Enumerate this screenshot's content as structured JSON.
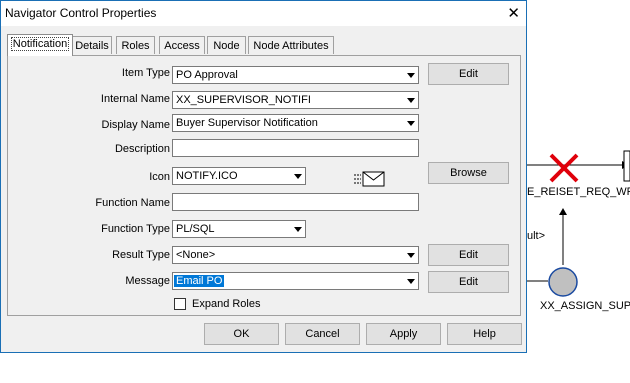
{
  "window": {
    "title": "Navigator Control Properties",
    "close_label": "✕"
  },
  "tabs": [
    {
      "label": "Notification",
      "active": true
    },
    {
      "label": "Details"
    },
    {
      "label": "Roles"
    },
    {
      "label": "Access"
    },
    {
      "label": "Node"
    },
    {
      "label": "Node Attributes"
    }
  ],
  "form": {
    "item_type": {
      "label": "Item Type",
      "value": "PO Approval",
      "edit_label": "Edit"
    },
    "internal_name": {
      "label": "Internal Name",
      "value": "XX_SUPERVISOR_NOTIFI"
    },
    "display_name": {
      "label": "Display Name",
      "value": "Buyer Supervisor Notification"
    },
    "description": {
      "label": "Description",
      "value": ""
    },
    "icon": {
      "label": "Icon",
      "value": "NOTIFY.ICO",
      "browse_label": "Browse",
      "preview": "envelope-icon"
    },
    "function_name": {
      "label": "Function Name",
      "value": ""
    },
    "function_type": {
      "label": "Function Type",
      "value": "PL/SQL"
    },
    "result_type": {
      "label": "Result Type",
      "value": "<None>",
      "edit_label": "Edit"
    },
    "message": {
      "label": "Message",
      "value": "Email PO",
      "edit_label": "Edit"
    },
    "expand_roles": {
      "label": "Expand Roles",
      "checked": false
    }
  },
  "footer": {
    "ok": "OK",
    "cancel": "Cancel",
    "apply": "Apply",
    "help": "Help"
  },
  "workflow": {
    "node1_label": "E_REISET_REQ_WF_",
    "result_label": "ult>",
    "node2_label": "XX_ASSIGN_SUP",
    "x_color": "#e0000b",
    "node_color": "#c0c0c0"
  }
}
